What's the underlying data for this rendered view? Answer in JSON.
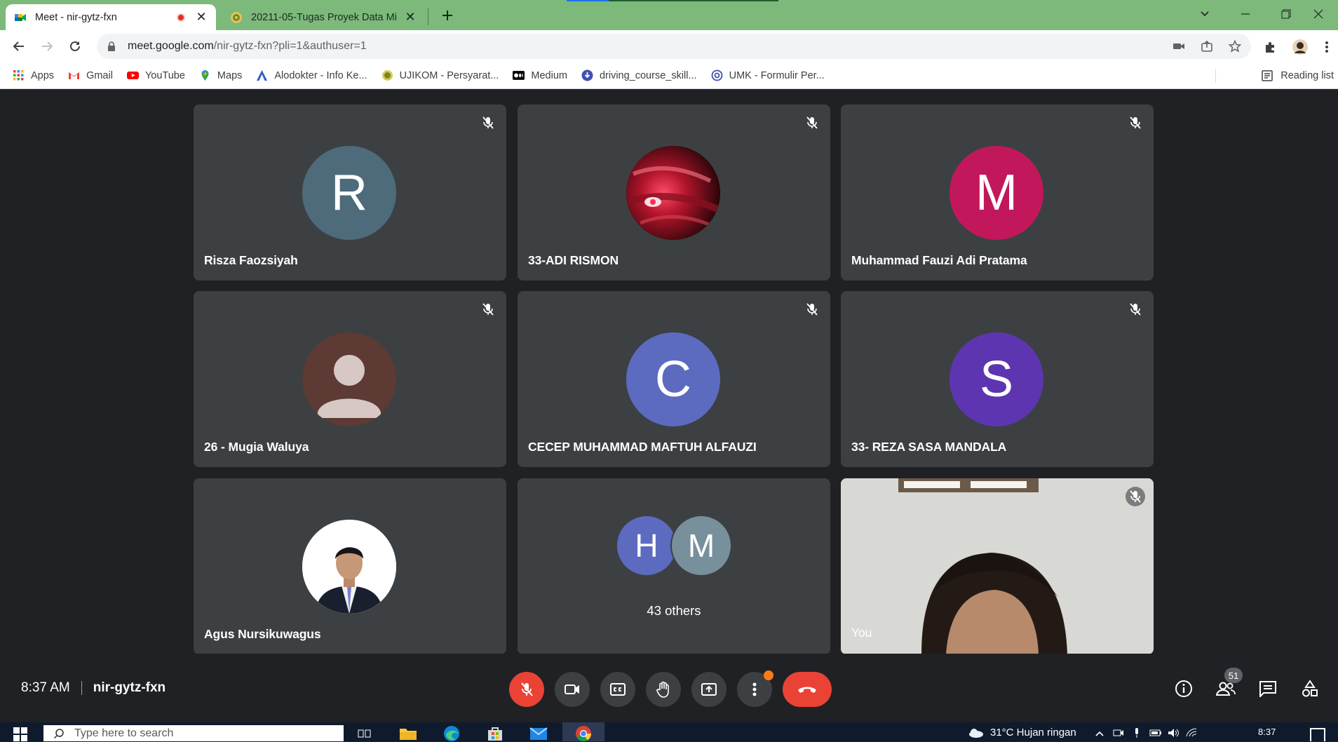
{
  "browser": {
    "tabs": [
      {
        "title": "Meet - nir-gytz-fxn",
        "active": true,
        "recording": true
      },
      {
        "title": "20211-05-Tugas Proyek Data Mi",
        "active": false
      }
    ],
    "address": {
      "host": "meet.google.com",
      "path": "/nir-gytz-fxn?pli=1&authuser=1"
    },
    "bookmarks": [
      {
        "label": "Apps",
        "icon": "apps-grid-icon"
      },
      {
        "label": "Gmail",
        "icon": "gmail-icon"
      },
      {
        "label": "YouTube",
        "icon": "youtube-icon"
      },
      {
        "label": "Maps",
        "icon": "maps-pin-icon"
      },
      {
        "label": "Alodokter - Info Ke...",
        "icon": "alodokter-icon"
      },
      {
        "label": "UJIKOM - Persyarat...",
        "icon": "ujikom-icon"
      },
      {
        "label": "Medium",
        "icon": "medium-icon"
      },
      {
        "label": "driving_course_skill...",
        "icon": "download-icon"
      },
      {
        "label": "UMK - Formulir Per...",
        "icon": "umk-icon"
      }
    ],
    "reading_list": "Reading list"
  },
  "participants": [
    {
      "name": "Risza Faozsiyah",
      "initial": "R",
      "color": "#4e6b7b",
      "muted": true
    },
    {
      "name": "33-ADI RISMON",
      "initial": "",
      "color": "#7a1020",
      "muted": true,
      "photo": "red-abstract"
    },
    {
      "name": "Muhammad Fauzi Adi Pratama",
      "initial": "M",
      "color": "#c2185b",
      "muted": true
    },
    {
      "name": "26 - Mugia Waluya",
      "initial": "",
      "color": "#5d3a33",
      "muted": true,
      "photo": "default-person"
    },
    {
      "name": "CECEP MUHAMMAD MAFTUH ALFAUZI",
      "initial": "C",
      "color": "#5c6bc0",
      "muted": true
    },
    {
      "name": "33- REZA SASA MANDALA",
      "initial": "S",
      "color": "#5e35b1",
      "muted": true
    },
    {
      "name": "Agus Nursikuwagus",
      "initial": "",
      "color": "#ffffff",
      "muted": false,
      "photo": "formal-portrait"
    }
  ],
  "others_tile": {
    "initials": [
      {
        "letter": "H",
        "color": "#5c6bc0"
      },
      {
        "letter": "M",
        "color": "#78909c"
      }
    ],
    "label": "43 others"
  },
  "self_tile": {
    "name": "You",
    "muted": true
  },
  "meeting": {
    "time": "8:37 AM",
    "code": "nir-gytz-fxn",
    "participant_count": "51",
    "more_options_notification": true
  },
  "taskbar": {
    "search_placeholder": "Type here to search",
    "weather": "31°C  Hujan ringan",
    "clock": "8:37"
  },
  "colors": {
    "meet_bg": "#202124",
    "tile_bg": "#3c4043",
    "danger": "#ea4335",
    "tab_strip": "#7cb97b"
  }
}
